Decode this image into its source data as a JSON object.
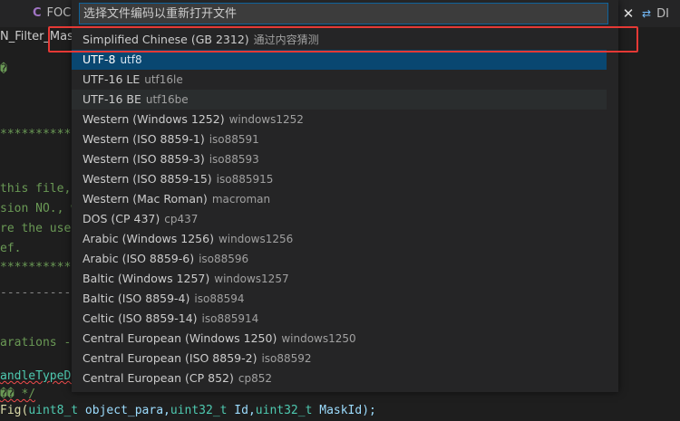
{
  "tabs": [
    {
      "label": "FOC",
      "icon": "c-file-icon"
    },
    {
      "label": "DI",
      "icon": "diff-icon"
    }
  ],
  "breadcrumb": "N_Filter_Mask_",
  "code": {
    "line1": "�",
    "line2": "*************",
    "line3": "this file,",
    "line4": "sion NO., w",
    "line5": "re the user",
    "line6": "ef.",
    "line7": "*************",
    "line8": "------------",
    "line9": "arations ---",
    "line10": "andleTypeDe",
    "line11": "�� */",
    "line12_fn": "Fig(",
    "line12_t1": "uint8_t",
    "line12_p1": " object_para,",
    "line12_t2": "uint32_t",
    "line12_p2": " Id,",
    "line12_t3": "uint32_t",
    "line12_p3": " MaskId);"
  },
  "quickpick": {
    "placeholder": "选择文件编码以重新打开文件",
    "close_glyph": "✕",
    "items": [
      {
        "label": "Simplified Chinese (GB 2312)",
        "desc": "通过内容猜测"
      },
      {
        "label": "UTF-8",
        "desc": "utf8"
      },
      {
        "label": "UTF-16 LE",
        "desc": "utf16le"
      },
      {
        "label": "UTF-16 BE",
        "desc": "utf16be"
      },
      {
        "label": "Western (Windows 1252)",
        "desc": "windows1252"
      },
      {
        "label": "Western (ISO 8859-1)",
        "desc": "iso88591"
      },
      {
        "label": "Western (ISO 8859-3)",
        "desc": "iso88593"
      },
      {
        "label": "Western (ISO 8859-15)",
        "desc": "iso885915"
      },
      {
        "label": "Western (Mac Roman)",
        "desc": "macroman"
      },
      {
        "label": "DOS (CP 437)",
        "desc": "cp437"
      },
      {
        "label": "Arabic (Windows 1256)",
        "desc": "windows1256"
      },
      {
        "label": "Arabic (ISO 8859-6)",
        "desc": "iso88596"
      },
      {
        "label": "Baltic (Windows 1257)",
        "desc": "windows1257"
      },
      {
        "label": "Baltic (ISO 8859-4)",
        "desc": "iso88594"
      },
      {
        "label": "Celtic (ISO 8859-14)",
        "desc": "iso885914"
      },
      {
        "label": "Central European (Windows 1250)",
        "desc": "windows1250"
      },
      {
        "label": "Central European (ISO 8859-2)",
        "desc": "iso88592"
      },
      {
        "label": "Central European (CP 852)",
        "desc": "cp852"
      }
    ]
  },
  "colors": {
    "active_item": "#094771",
    "highlight_border": "#e53935",
    "input_border": "#0e639c"
  }
}
